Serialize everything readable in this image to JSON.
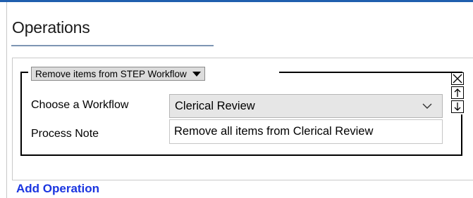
{
  "section": {
    "title": "Operations"
  },
  "operation": {
    "type_label": "Remove items from STEP Workflow",
    "controls": {
      "remove_icon": "close-x-icon",
      "up_icon": "arrow-up-icon",
      "down_icon": "arrow-down-icon"
    },
    "fields": {
      "workflow_label": "Choose a Workflow",
      "workflow_value": "Clerical Review",
      "note_label": "Process Note",
      "note_value": "Remove all items from Clerical Review"
    }
  },
  "actions": {
    "add_operation": "Add Operation"
  },
  "colors": {
    "accent_bar": "#1f5fae",
    "link": "#1a35e0",
    "select_bg": "#e6e6e6"
  }
}
